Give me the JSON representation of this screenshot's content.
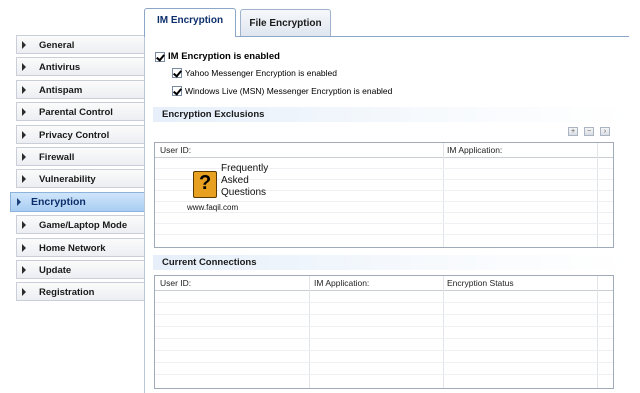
{
  "sidebar": {
    "items": [
      {
        "label": "General"
      },
      {
        "label": "Antivirus"
      },
      {
        "label": "Antispam"
      },
      {
        "label": "Parental Control"
      },
      {
        "label": "Privacy Control"
      },
      {
        "label": "Firewall"
      },
      {
        "label": "Vulnerability"
      },
      {
        "label": "Encryption",
        "active": true
      },
      {
        "label": "Game/Laptop Mode"
      },
      {
        "label": "Home Network"
      },
      {
        "label": "Update"
      },
      {
        "label": "Registration"
      }
    ]
  },
  "tabs": [
    {
      "label": "IM Encryption",
      "active": true
    },
    {
      "label": "File Encryption",
      "active": false
    }
  ],
  "im": {
    "main_checkbox": "IM Encryption is enabled",
    "yahoo_checkbox": "Yahoo Messenger Encryption is enabled",
    "msn_checkbox": "Windows Live (MSN) Messenger Encryption is enabled"
  },
  "exclusions": {
    "title": "Encryption Exclusions",
    "columns": [
      "User ID:",
      "IM Application:"
    ]
  },
  "connections": {
    "title": "Current Connections",
    "columns": [
      "User ID:",
      "IM Application:",
      "Encryption Status"
    ]
  },
  "watermark": {
    "words": [
      "Frequently",
      "Asked",
      "Questions"
    ],
    "url": "www.faqil.com",
    "glyph": "?"
  },
  "icons": {
    "sidebar_arrow": "triangle-right-icon",
    "add": "add-icon",
    "remove": "remove-icon",
    "edit": "edit-icon"
  },
  "colors": {
    "active_item": "#bcd9f7",
    "accent_text": "#0c2f6b",
    "logo_orange": "#e8a020"
  }
}
